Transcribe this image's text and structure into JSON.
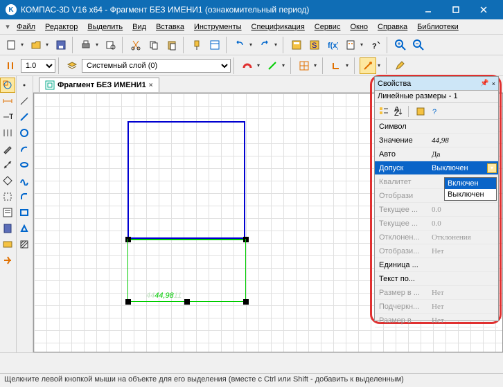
{
  "title": "КОМПАС-3D V16  x64 - Фрагмент БЕЗ ИМЕНИ1 (ознакомительный период)",
  "menu": {
    "file": "Файл",
    "edit": "Редактор",
    "select": "Выделить",
    "view": "Вид",
    "insert": "Вставка",
    "tools": "Инструменты",
    "spec": "Спецификация",
    "service": "Сервис",
    "window": "Окно",
    "help": "Справка",
    "lib": "Библиотеки"
  },
  "toolbar2": {
    "scale": "1.0",
    "layer": "Системный слой (0)"
  },
  "tab": {
    "name": "Фрагмент БЕЗ ИМЕНИ1"
  },
  "dim": {
    "pre": "44",
    "val": "44,98",
    "post": "11"
  },
  "props": {
    "title": "Свойства",
    "sub": "Линейные размеры - 1",
    "symbol_k": "Символ",
    "symbol_v": "",
    "value_k": "Значение",
    "value_v": "44,98",
    "auto_k": "Авто",
    "auto_v": "Да",
    "tol_k": "Допуск",
    "tol_v": "Выключен",
    "qual_k": "Квалитет",
    "qual_v": "",
    "show1_k": "Отобрази",
    "show1_v": "",
    "cur1_k": "Текущее ...",
    "cur1_v": "0.0",
    "cur2_k": "Текущее ...",
    "cur2_v": "0.0",
    "dev_k": "Отклонен...",
    "dev_v": "Отклонения",
    "show2_k": "Отобрази...",
    "show2_v": "Нет",
    "unit_k": "Единица ...",
    "unit_v": "",
    "text_k": "Текст по...",
    "text_v": "",
    "dim1_k": "Размер в ...",
    "dim1_v": "Нет",
    "under_k": "Подчеркн...",
    "under_v": "Нет",
    "dim2_k": "Размер в",
    "dim2_v": "Нет",
    "opts": {
      "on": "Включен",
      "off": "Выключен"
    }
  },
  "status": "Щелкните левой кнопкой мыши на объекте для его выделения (вместе с Ctrl или Shift - добавить к выделенным)"
}
